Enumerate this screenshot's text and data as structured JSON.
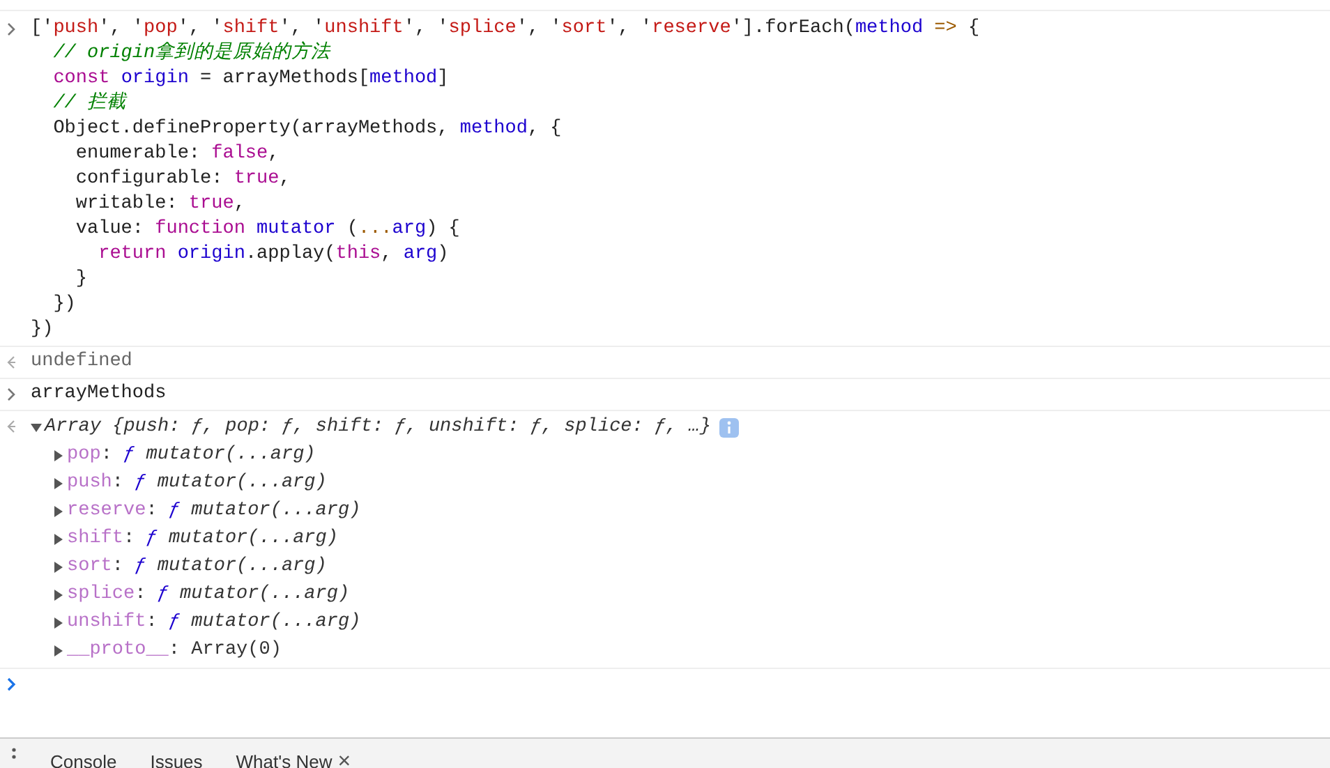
{
  "entries": [
    {
      "kind": "input",
      "lines": [
        [
          {
            "text": "['",
            "kind": "plain"
          },
          {
            "text": "push",
            "kind": "string"
          },
          {
            "text": "', '",
            "kind": "plain"
          },
          {
            "text": "pop",
            "kind": "string"
          },
          {
            "text": "', '",
            "kind": "plain"
          },
          {
            "text": "shift",
            "kind": "string"
          },
          {
            "text": "', '",
            "kind": "plain"
          },
          {
            "text": "unshift",
            "kind": "string"
          },
          {
            "text": "', '",
            "kind": "plain"
          },
          {
            "text": "splice",
            "kind": "string"
          },
          {
            "text": "', '",
            "kind": "plain"
          },
          {
            "text": "sort",
            "kind": "string"
          },
          {
            "text": "', '",
            "kind": "plain"
          },
          {
            "text": "reserve",
            "kind": "string"
          },
          {
            "text": "'].forEach(",
            "kind": "plain"
          },
          {
            "text": "method",
            "kind": "variable"
          },
          {
            "text": " => ",
            "kind": "operator"
          },
          {
            "text": "{",
            "kind": "plain"
          }
        ],
        [
          {
            "text": "  // origin拿到的是原始的方法",
            "kind": "comment"
          }
        ],
        [
          {
            "text": "  const ",
            "kind": "keyword"
          },
          {
            "text": "origin",
            "kind": "variable"
          },
          {
            "text": " = arrayMethods[",
            "kind": "plain"
          },
          {
            "text": "method",
            "kind": "variable"
          },
          {
            "text": "]",
            "kind": "plain"
          }
        ],
        [
          {
            "text": "  // 拦截",
            "kind": "comment"
          }
        ],
        [
          {
            "text": "  Object.defineProperty(arrayMethods, ",
            "kind": "plain"
          },
          {
            "text": "method",
            "kind": "variable"
          },
          {
            "text": ", {",
            "kind": "plain"
          }
        ],
        [
          {
            "text": "    enumerable: ",
            "kind": "plain"
          },
          {
            "text": "false",
            "kind": "keyword"
          },
          {
            "text": ",",
            "kind": "plain"
          }
        ],
        [
          {
            "text": "    configurable: ",
            "kind": "plain"
          },
          {
            "text": "true",
            "kind": "keyword"
          },
          {
            "text": ",",
            "kind": "plain"
          }
        ],
        [
          {
            "text": "    writable: ",
            "kind": "plain"
          },
          {
            "text": "true",
            "kind": "keyword"
          },
          {
            "text": ",",
            "kind": "plain"
          }
        ],
        [
          {
            "text": "    value: ",
            "kind": "plain"
          },
          {
            "text": "function ",
            "kind": "keyword"
          },
          {
            "text": "mutator",
            "kind": "variable"
          },
          {
            "text": " (",
            "kind": "plain"
          },
          {
            "text": "...",
            "kind": "operator"
          },
          {
            "text": "arg",
            "kind": "variable"
          },
          {
            "text": ") {",
            "kind": "plain"
          }
        ],
        [
          {
            "text": "      return ",
            "kind": "keyword"
          },
          {
            "text": "origin",
            "kind": "variable"
          },
          {
            "text": ".applay(",
            "kind": "plain"
          },
          {
            "text": "this",
            "kind": "keyword"
          },
          {
            "text": ", ",
            "kind": "plain"
          },
          {
            "text": "arg",
            "kind": "variable"
          },
          {
            "text": ")",
            "kind": "plain"
          }
        ],
        [
          {
            "text": "    }",
            "kind": "plain"
          }
        ],
        [
          {
            "text": "  })",
            "kind": "plain"
          }
        ],
        [
          {
            "text": "})",
            "kind": "plain"
          }
        ]
      ]
    },
    {
      "kind": "output",
      "text": "undefined"
    },
    {
      "kind": "input",
      "lines": [
        [
          {
            "text": "arrayMethods",
            "kind": "plain"
          }
        ]
      ]
    },
    {
      "kind": "object",
      "expanded": true,
      "summary": "Array {push: ƒ, pop: ƒ, shift: ƒ, unshift: ƒ, splice: ƒ, …}",
      "properties": [
        {
          "separator": ":",
          "key": "pop",
          "marker": "ƒ",
          "value": "mutator(...arg)",
          "expanded": false
        },
        {
          "separator": ":",
          "key": "push",
          "marker": "ƒ",
          "value": "mutator(...arg)",
          "expanded": false
        },
        {
          "separator": ":",
          "key": "reserve",
          "marker": "ƒ",
          "value": "mutator(...arg)",
          "expanded": false
        },
        {
          "separator": ":",
          "key": "shift",
          "marker": "ƒ",
          "value": "mutator(...arg)",
          "expanded": false
        },
        {
          "separator": ":",
          "key": "sort",
          "marker": "ƒ",
          "value": "mutator(...arg)",
          "expanded": false
        },
        {
          "separator": ":",
          "key": "splice",
          "marker": "ƒ",
          "value": "mutator(...arg)",
          "expanded": false
        },
        {
          "separator": ":",
          "key": "unshift",
          "marker": "ƒ",
          "value": "mutator(...arg)",
          "expanded": false
        },
        {
          "separator": ":",
          "key": "__proto__",
          "value": "Array(0)",
          "expanded": false
        }
      ]
    }
  ],
  "drawer_tabs": [
    {
      "label": "Console",
      "selected": false,
      "closable": false
    },
    {
      "label": "Issues",
      "selected": false,
      "closable": false
    },
    {
      "label": "What's New",
      "selected": false,
      "closable": true
    }
  ],
  "drawer_close": "×"
}
